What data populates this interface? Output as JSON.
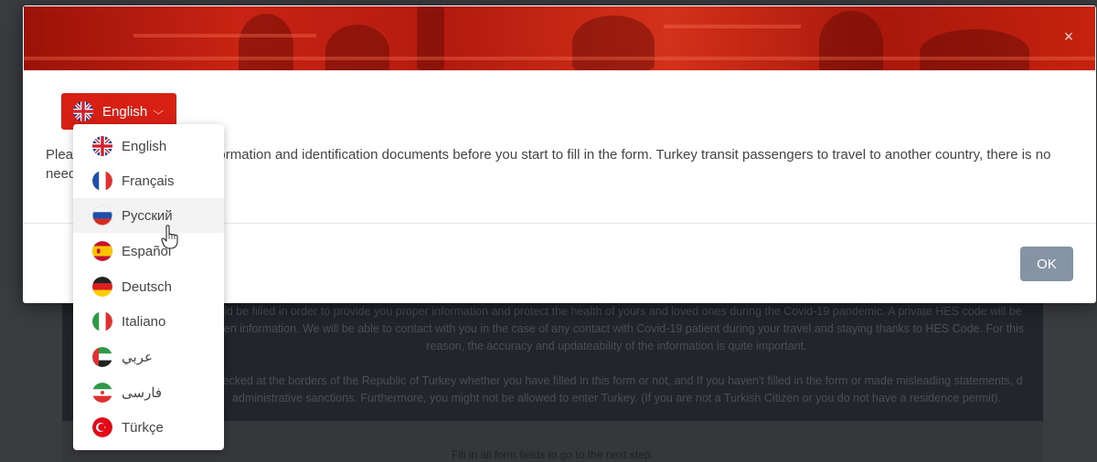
{
  "background": {
    "paragraph1": "ould be filled in order to provide you proper information and protect the health of yours and loved ones during the Covid-19 pandemic. A private HES code will be given information. We will be able to contact with you in the case of any contact with Covid-19 patient during your travel and staying thanks to HES Code. For this reason, the accuracy and updateability of the information is quite important.",
    "paragraph2": "checked at the borders of the Republic of Turkey whether you have filled in this form or not, and If you haven't filled in the form or made misleading statements, d administrative sanctions. Furthermore, you might not be allowed to enter Turkey. (If you are not a Turkish Citizen or you do not have a residence permit).",
    "footer": "Fill in all form fields to go to the next step."
  },
  "modal": {
    "close_icon": "×",
    "language_button": {
      "label": "English",
      "icon": "uk-flag-icon",
      "chevron": "⌵"
    },
    "info_text_line1": "Plea                                      ormation and identification documents before you start to fill in the form. Turkey transit passengers to travel to another country, there is no",
    "info_text_line2": "need",
    "ok_label": "OK",
    "colors": {
      "accent": "#d71f14",
      "ok": "#8593a3"
    }
  },
  "languages": [
    {
      "label": "English",
      "icon": "uk-flag-icon"
    },
    {
      "label": "Français",
      "icon": "france-flag-icon"
    },
    {
      "label": "Русский",
      "icon": "russia-flag-icon"
    },
    {
      "label": "Español",
      "icon": "spain-flag-icon"
    },
    {
      "label": "Deutsch",
      "icon": "germany-flag-icon"
    },
    {
      "label": "Italiano",
      "icon": "italy-flag-icon"
    },
    {
      "label": "عربي",
      "icon": "uae-flag-icon"
    },
    {
      "label": "فارسی",
      "icon": "iran-flag-icon"
    },
    {
      "label": "Türkçe",
      "icon": "turkey-flag-icon"
    }
  ],
  "hovered_language": "Русский"
}
